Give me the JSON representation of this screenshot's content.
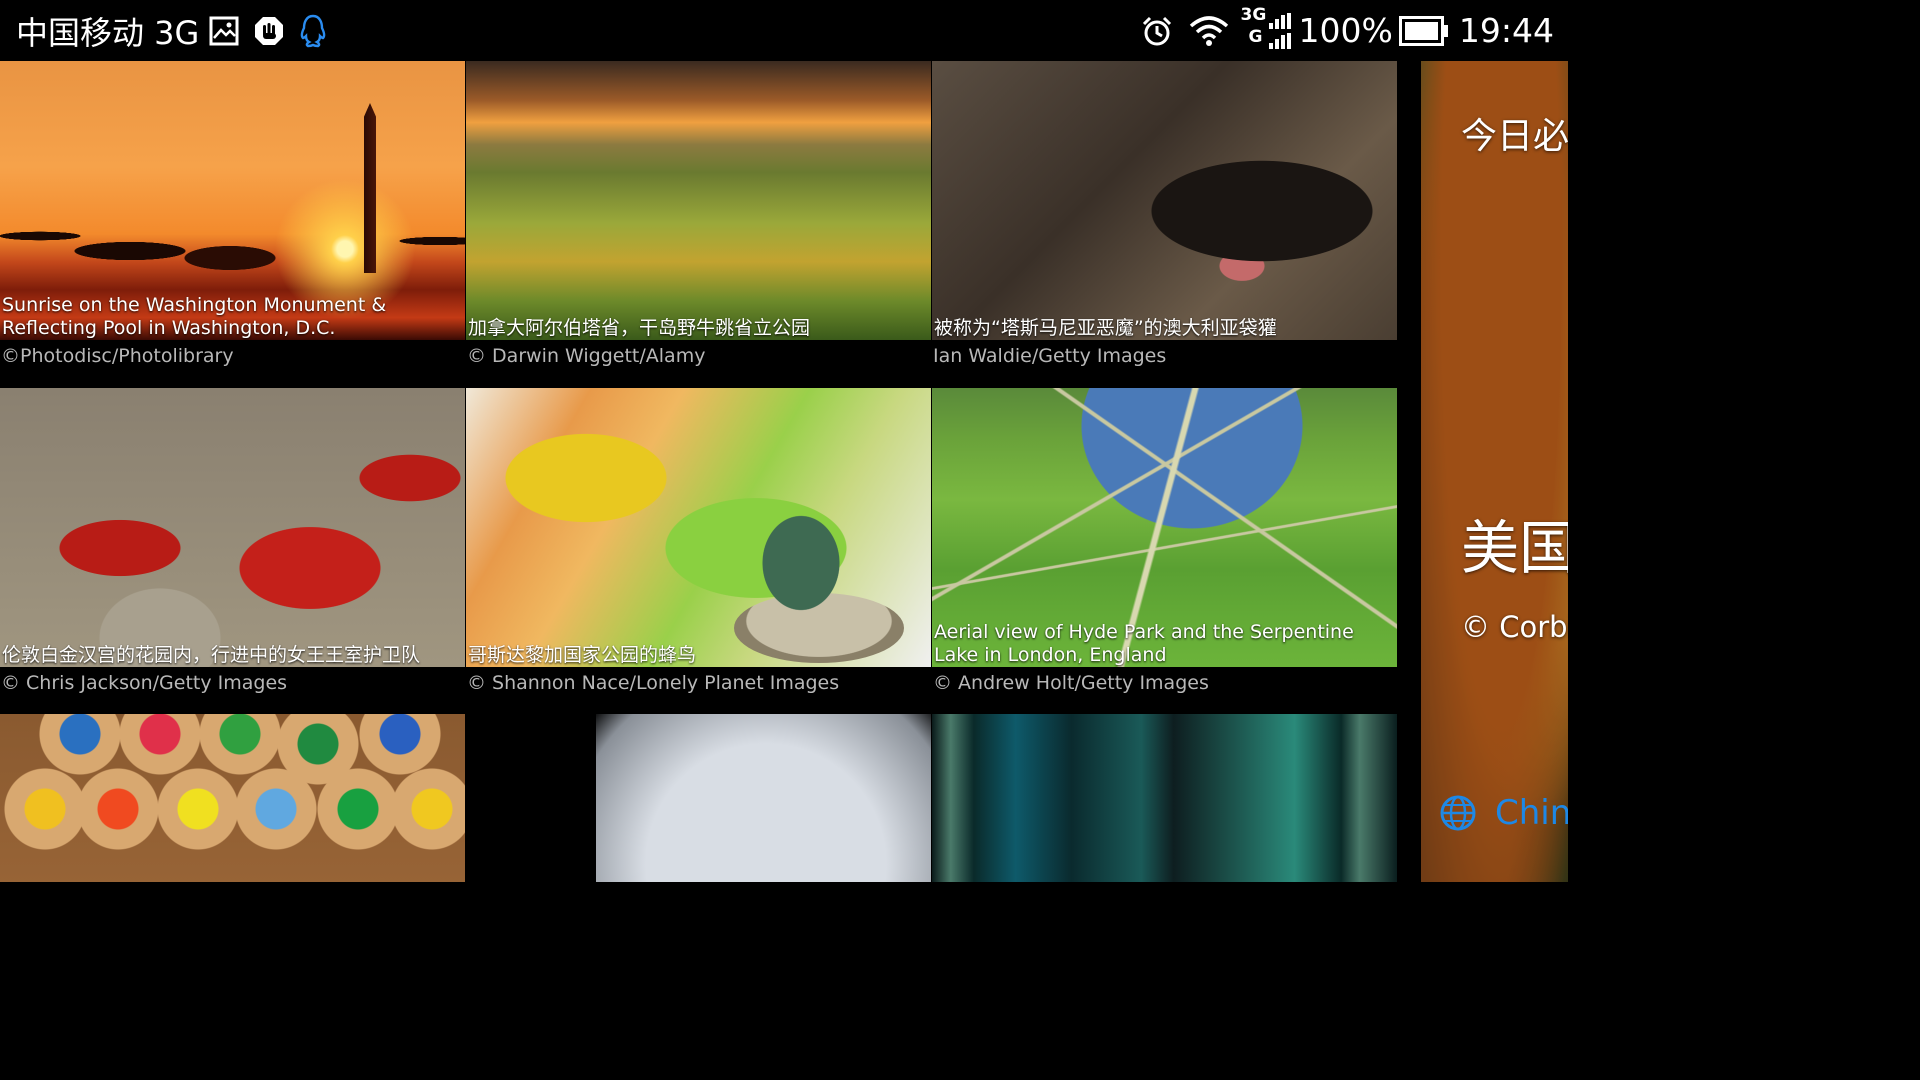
{
  "status_bar": {
    "carrier": "中国移动 3G",
    "network_label": "3G",
    "network_sub": "G",
    "battery": "100%",
    "time": "19:44"
  },
  "gallery": {
    "tiles": [
      {
        "caption": "Sunrise on the Washington Monument & Reflecting Pool in Washington, D.C.",
        "credit": "©Photodisc/Photolibrary"
      },
      {
        "caption": "加拿大阿尔伯塔省，干岛野牛跳省立公园",
        "credit": "© Darwin Wiggett/Alamy"
      },
      {
        "caption": "被称为“塔斯马尼亚恶魔”的澳大利亚袋獾",
        "credit": "Ian Waldie/Getty Images"
      },
      {
        "caption": "伦敦白金汉宫的花园内，行进中的女王王室护卫队",
        "credit": "© Chris Jackson/Getty Images"
      },
      {
        "caption": "哥斯达黎加国家公园的蜂鸟",
        "credit": "© Shannon Nace/Lonely Planet Images"
      },
      {
        "caption": "Aerial view of Hyde Park and the Serpentine Lake in London, England",
        "credit": "© Andrew Holt/Getty Images"
      },
      {
        "caption": "",
        "credit": ""
      },
      {
        "caption": "",
        "credit": ""
      },
      {
        "caption": "",
        "credit": ""
      }
    ]
  },
  "preview": {
    "heading": "今日必应",
    "title": "美国",
    "credit": "© Corbis",
    "region": "China"
  },
  "colors": {
    "background": "#000000",
    "credit_text": "#b8b8b8",
    "accent_blue": "#1e88e5",
    "qq_blue": "#1e88e5"
  }
}
